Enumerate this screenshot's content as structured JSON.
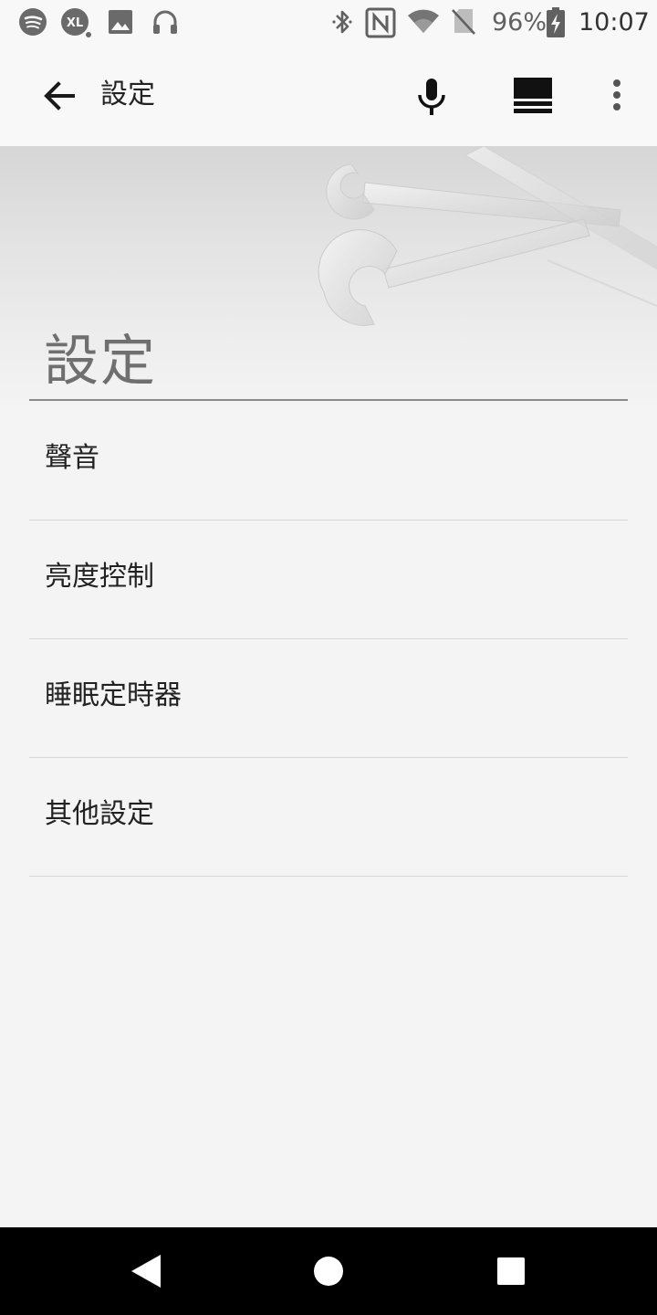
{
  "status_bar": {
    "left_icons": [
      "spotify-icon",
      "xl-app-icon",
      "image-icon",
      "headphones-icon"
    ],
    "right_icons": [
      "bluetooth-icon",
      "nfc-icon",
      "wifi-icon",
      "no-sim-icon",
      "battery-charging-icon"
    ],
    "battery_percent": "96%",
    "time": "10:07"
  },
  "app_bar": {
    "title": "設定",
    "back_icon": "arrow-back-icon",
    "mic_icon": "microphone-icon",
    "view_icon": "list-view-icon",
    "more_icon": "more-vert-icon"
  },
  "header": {
    "title": "設定",
    "art": "wrenches-icon"
  },
  "menu": {
    "items": [
      {
        "label": "聲音"
      },
      {
        "label": "亮度控制"
      },
      {
        "label": "睡眠定時器"
      },
      {
        "label": "其他設定"
      }
    ]
  },
  "nav_bar": {
    "back_icon": "nav-back-icon",
    "home_icon": "nav-home-icon",
    "recents_icon": "nav-recents-icon"
  },
  "colors": {
    "background": "#f4f4f4",
    "bar": "#f8f8f8",
    "nav": "#000000",
    "text": "#222222",
    "section_title": "#6f6f6f",
    "divider": "#d8d8d8"
  }
}
